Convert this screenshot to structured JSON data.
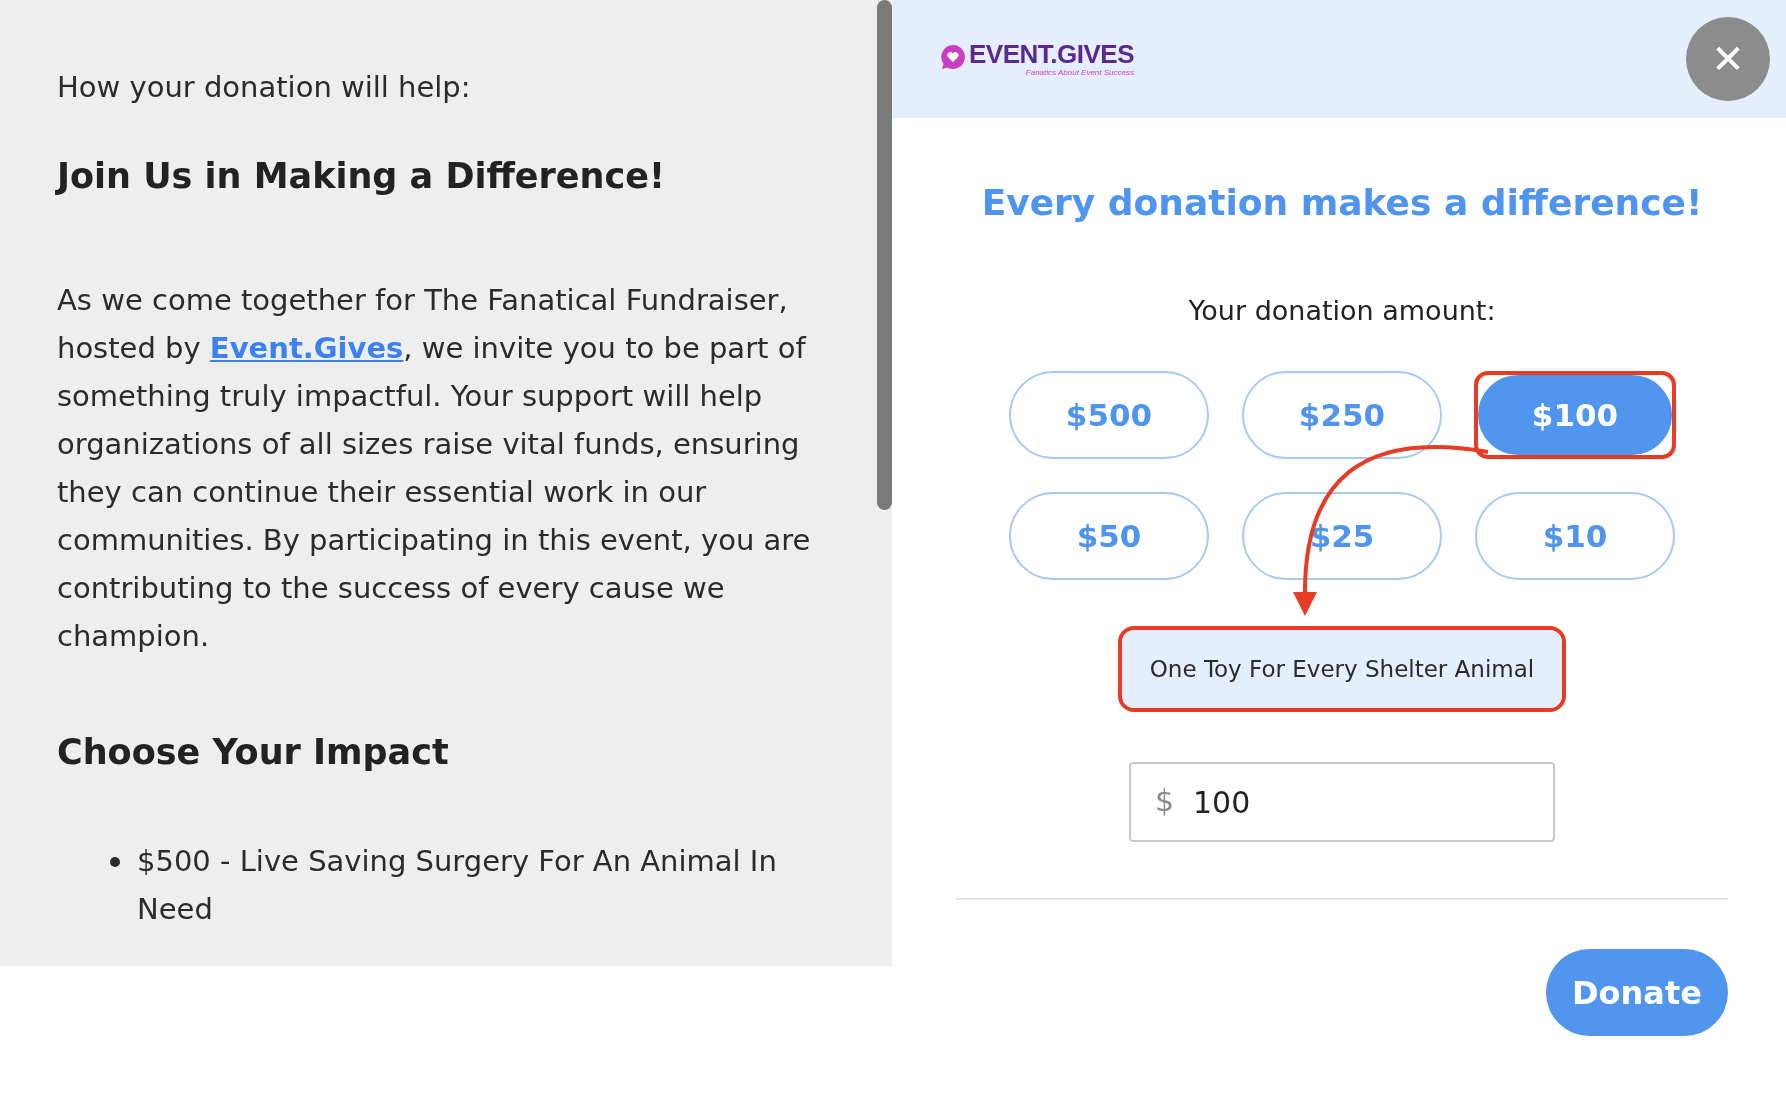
{
  "left_panel": {
    "intro": "How your donation will help:",
    "heading": "Join Us in Making a Difference!",
    "paragraph": {
      "before_link": "As we come together for The Fanatical Fundraiser, hosted by",
      "link": "Event.Gives",
      "after_link": ", we invite you to be part of something truly impactful. Your support will help organizations of all sizes raise vital funds, ensuring they can continue their essential work in our communities. By participating in this event, you are contributing to the success of every cause we champion."
    },
    "impact_heading": "Choose Your Impact",
    "impact_items": [
      {
        "text": "$500 - Live Saving Surgery For An Animal In Need"
      }
    ]
  },
  "donation_panel": {
    "logo": {
      "name": "EVENT.GIVES",
      "tagline": "Fanatics About Event Success"
    },
    "close_button": "✕",
    "title": "Every donation makes a difference!",
    "amount_label": "Your donation amount:",
    "amounts": [
      {
        "label": "$500",
        "selected": false,
        "highlighted": false
      },
      {
        "label": "$250",
        "selected": false,
        "highlighted": false
      },
      {
        "label": "$100",
        "selected": true,
        "highlighted": true
      },
      {
        "label": "$50",
        "selected": false,
        "highlighted": false
      },
      {
        "label": "$25",
        "selected": false,
        "highlighted": false
      },
      {
        "label": "$10",
        "selected": false,
        "highlighted": false
      }
    ],
    "cause": {
      "text": "One Toy For Every Shelter Animal",
      "highlighted": true
    },
    "amount_field": {
      "prefix": "$",
      "value": "100"
    },
    "donate_button": "Donate"
  }
}
